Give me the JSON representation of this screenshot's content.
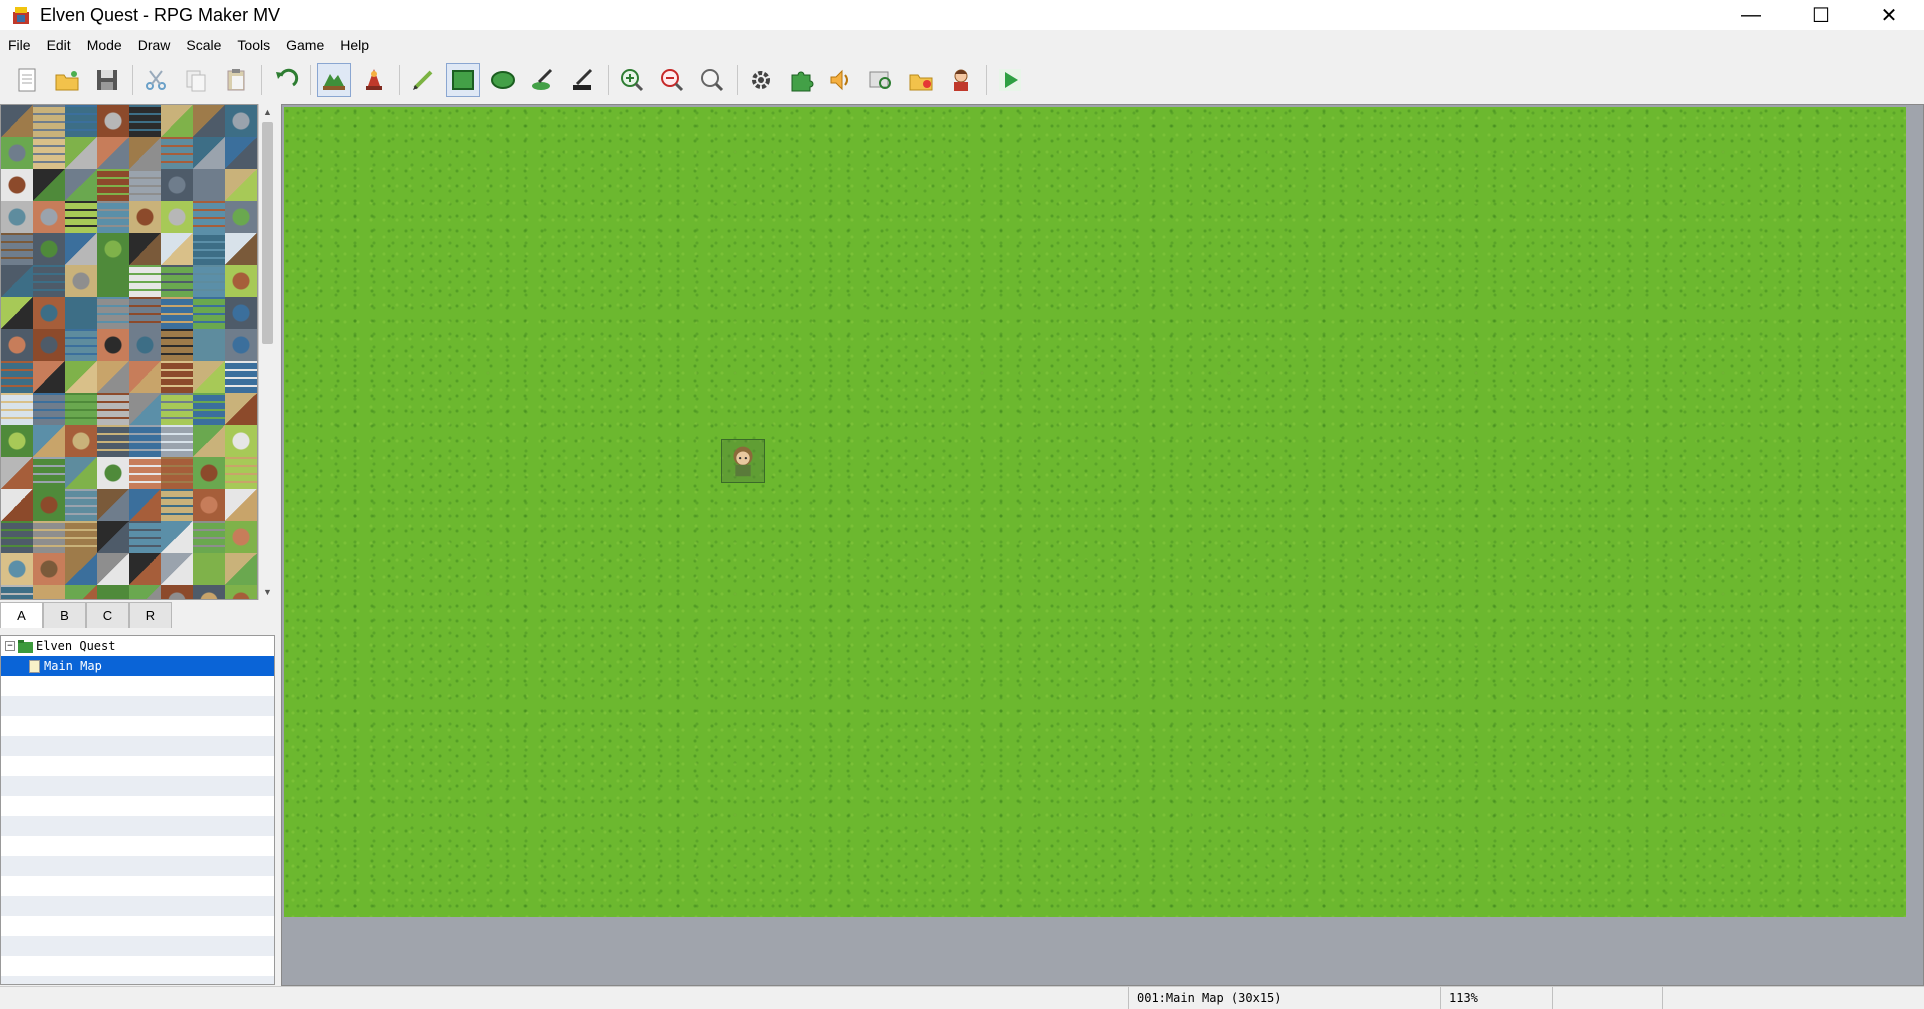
{
  "window": {
    "title": "Elven Quest - RPG Maker MV",
    "minimize_glyph": "—",
    "maximize_glyph": "☐",
    "close_glyph": "✕"
  },
  "menubar": {
    "items": [
      "File",
      "Edit",
      "Mode",
      "Draw",
      "Scale",
      "Tools",
      "Game",
      "Help"
    ]
  },
  "toolbar": {
    "groups": [
      [
        "new-project-icon",
        "open-project-icon",
        "save-project-icon"
      ],
      [
        "cut-icon",
        "copy-icon",
        "paste-icon"
      ],
      [
        "undo-icon"
      ],
      [
        "map-mode-icon",
        "event-mode-icon"
      ],
      [
        "pencil-icon",
        "rectangle-icon",
        "ellipse-icon",
        "flood-fill-icon",
        "shadow-pen-icon"
      ],
      [
        "zoom-in-icon",
        "zoom-out-icon",
        "actual-size-icon"
      ],
      [
        "database-icon",
        "plugin-manager-icon",
        "sound-test-icon",
        "event-searcher-icon",
        "resource-manager-icon",
        "character-generator-icon"
      ],
      [
        "playtest-icon"
      ]
    ],
    "active": [
      "map-mode-icon",
      "rectangle-icon"
    ]
  },
  "tileset": {
    "tabs": [
      "A",
      "B",
      "C",
      "R"
    ],
    "active_tab": "A"
  },
  "map_tree": {
    "project": "Elven Quest",
    "maps": [
      {
        "label": "Main Map",
        "selected": true
      }
    ]
  },
  "map": {
    "name": "Main Map"
  },
  "statusbar": {
    "map_info": "001:Main Map (30x15)",
    "zoom": "113%"
  },
  "colors": {
    "grass": "#6cb82f",
    "selection": "#0a64d7",
    "map_bg": "#a0a4ac"
  }
}
